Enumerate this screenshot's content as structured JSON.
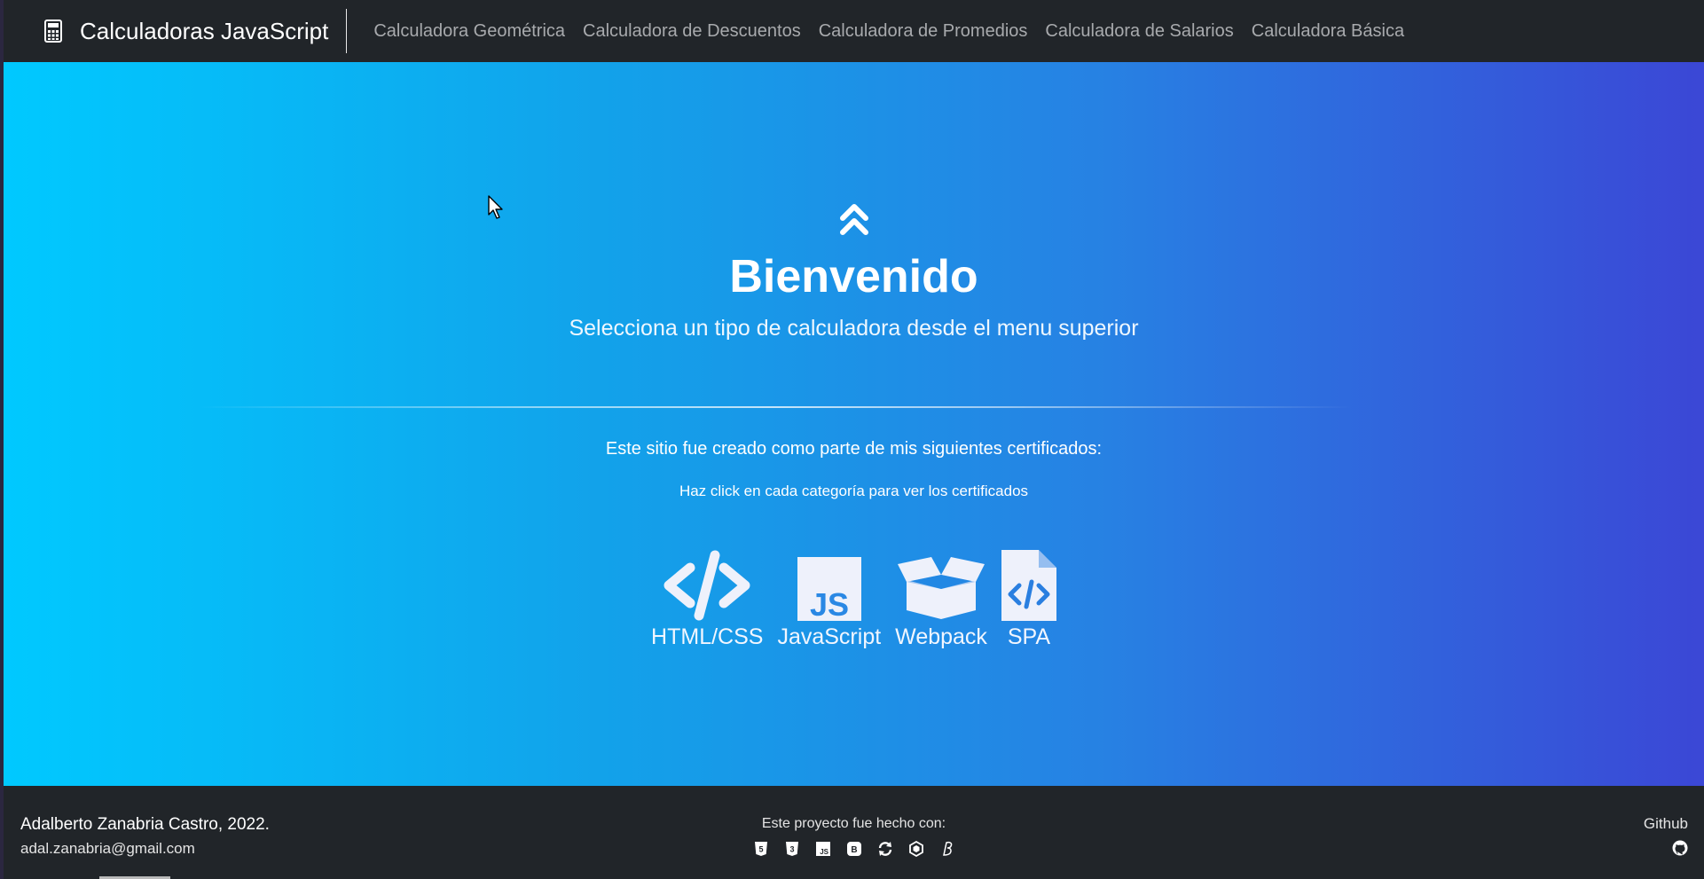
{
  "navbar": {
    "brand": "Calculadoras JavaScript",
    "brand_icon": "calculator-icon",
    "links": [
      "Calculadora Geométrica",
      "Calculadora de Descuentos",
      "Calculadora de Promedios",
      "Calculadora de Salarios",
      "Calculadora Básica"
    ]
  },
  "hero": {
    "icon": "chevrons-up-icon",
    "title": "Bienvenido",
    "subtitle": "Selecciona un tipo de calculadora desde el menu superior",
    "cert_text": "Este sitio fue creado como parte de mis siguientes certificados:",
    "cert_hint": "Haz click en cada categoría para ver los certificados",
    "certs": [
      {
        "label": "HTML/CSS",
        "icon": "code-icon"
      },
      {
        "label": "JavaScript",
        "icon": "js-icon"
      },
      {
        "label": "Webpack",
        "icon": "box-open-icon"
      },
      {
        "label": "SPA",
        "icon": "file-code-icon"
      }
    ],
    "colors": {
      "gradient_start": "#00c9ff",
      "gradient_end": "#3b47d6"
    }
  },
  "footer": {
    "author": "Adalberto Zanabria Castro, 2022.",
    "email": "adal.zanabria@gmail.com",
    "made_with": "Este proyecto fue hecho con:",
    "tech_icons": [
      "html5-icon",
      "css3-icon",
      "js-icon",
      "bootstrap-icon",
      "sync-icon",
      "webpack-icon",
      "babel-icon"
    ],
    "github_label": "Github",
    "github_icon": "github-icon"
  }
}
